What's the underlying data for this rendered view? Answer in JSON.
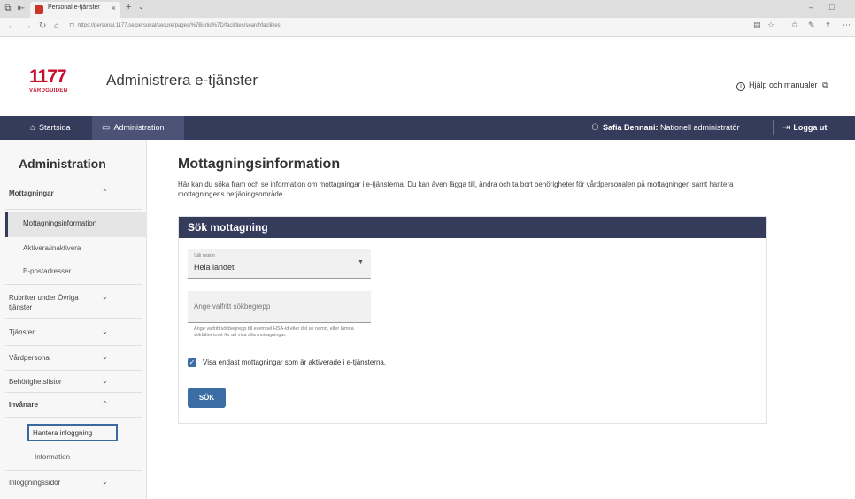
{
  "browser": {
    "tab_title": "Personal e-tjänster",
    "url": "https://personal.1177.se/personal/secure/pages/%7Burlid%7D/facilities/searchfacilities"
  },
  "site": {
    "logo_number": "1177",
    "logo_sub": "VÅRDGUIDEN",
    "title": "Administrera e-tjänster",
    "help": "Hjälp och manualer"
  },
  "topnav": {
    "home": "Startsida",
    "admin": "Administration",
    "user": "Safia Bennani:",
    "role": "Nationell administratör",
    "logout": "Logga ut"
  },
  "sidebar": {
    "title": "Administration",
    "mottagningar": "Mottagningar",
    "mottagningsinformation": "Mottagningsinformation",
    "aktivera": "Aktivera/inaktivera",
    "epost": "E-postadresser",
    "rubriker": "Rubriker under Övriga tjänster",
    "tjanster": "Tjänster",
    "vardpersonal": "Vårdpersonal",
    "behorighetslistor": "Behörighetslistor",
    "invanare": "Invånare",
    "hantera": "Hantera inloggning",
    "information": "Information",
    "inloggningssidor": "Inloggningssidor"
  },
  "main": {
    "heading": "Mottagningsinformation",
    "description": "Här kan du söka fram och se information om mottagningar i e-tjänsterna. Du kan även lägga till, ändra och ta bort behörigheter för vårdpersonalen på mottagningen samt hantera mottagningens betjäningsområde.",
    "card_title": "Sök mottagning",
    "region_label": "Välj region",
    "region_value": "Hela landet",
    "search_placeholder": "Ange valfritt sökbegrepp",
    "hint": "Ange valfritt sökbegrepp till exempel HSA-id eller del av namn, eller lämna sökfältet tomt för att visa alla mottagningar.",
    "checkbox_label": "Visa endast mottagningar som är aktiverade i e-tjänsterna.",
    "checkbox_checked": true,
    "search_button": "SÖK"
  },
  "colors": {
    "nav_bg": "#353b5a",
    "brand_red": "#c8102e",
    "button_blue": "#3b6ea5"
  }
}
